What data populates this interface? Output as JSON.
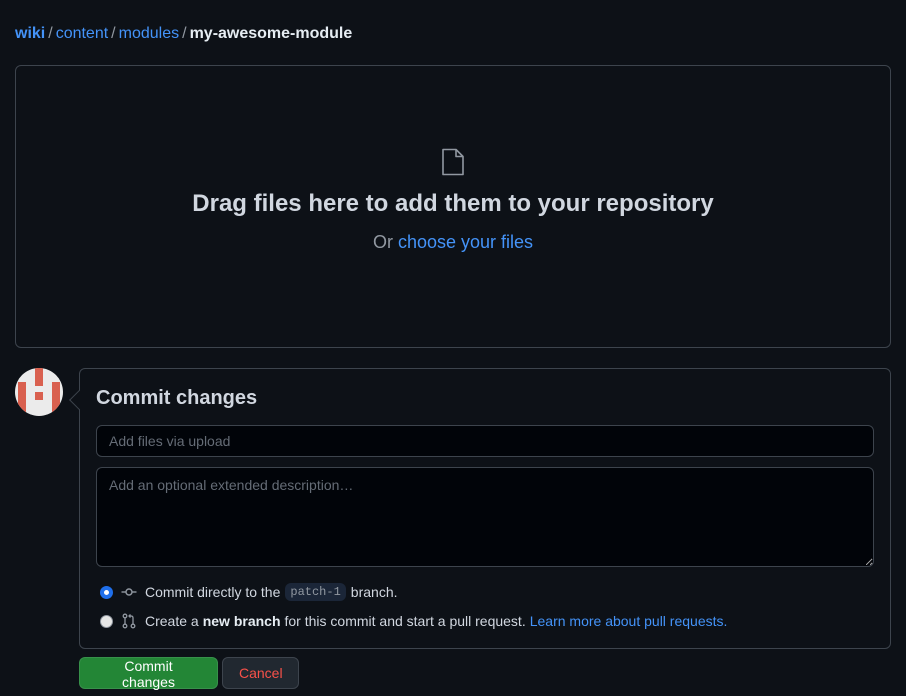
{
  "breadcrumb": {
    "items": [
      "wiki",
      "content",
      "modules"
    ],
    "separator": "/",
    "current": "my-awesome-module"
  },
  "dropzone": {
    "icon": "file-icon",
    "title": "Drag files here to add them to your repository",
    "prefix": "Or",
    "link": "choose your files"
  },
  "commit": {
    "avatar": "identicon-avatar",
    "title": "Commit changes",
    "summary_value": "",
    "summary_placeholder": "Add files via upload",
    "description_value": "",
    "description_placeholder": "Add an optional extended description…",
    "options": [
      {
        "selected": true,
        "icon": "git-commit-icon",
        "text_before": "Commit directly to the",
        "branch": "patch-1",
        "text_after": "branch."
      },
      {
        "selected": false,
        "icon": "git-pull-request-icon",
        "text_before": "Create a",
        "bold": "new branch",
        "text_after": "for this commit and start a pull request.",
        "link": "Learn more about pull requests."
      }
    ]
  },
  "buttons": {
    "commit": "Commit changes",
    "cancel": "Cancel"
  },
  "colors": {
    "accent": "#4493f8",
    "primary_button": "#238636",
    "danger_text": "#f85149",
    "background": "#0d1117",
    "avatar_fg": "#d9604f"
  }
}
